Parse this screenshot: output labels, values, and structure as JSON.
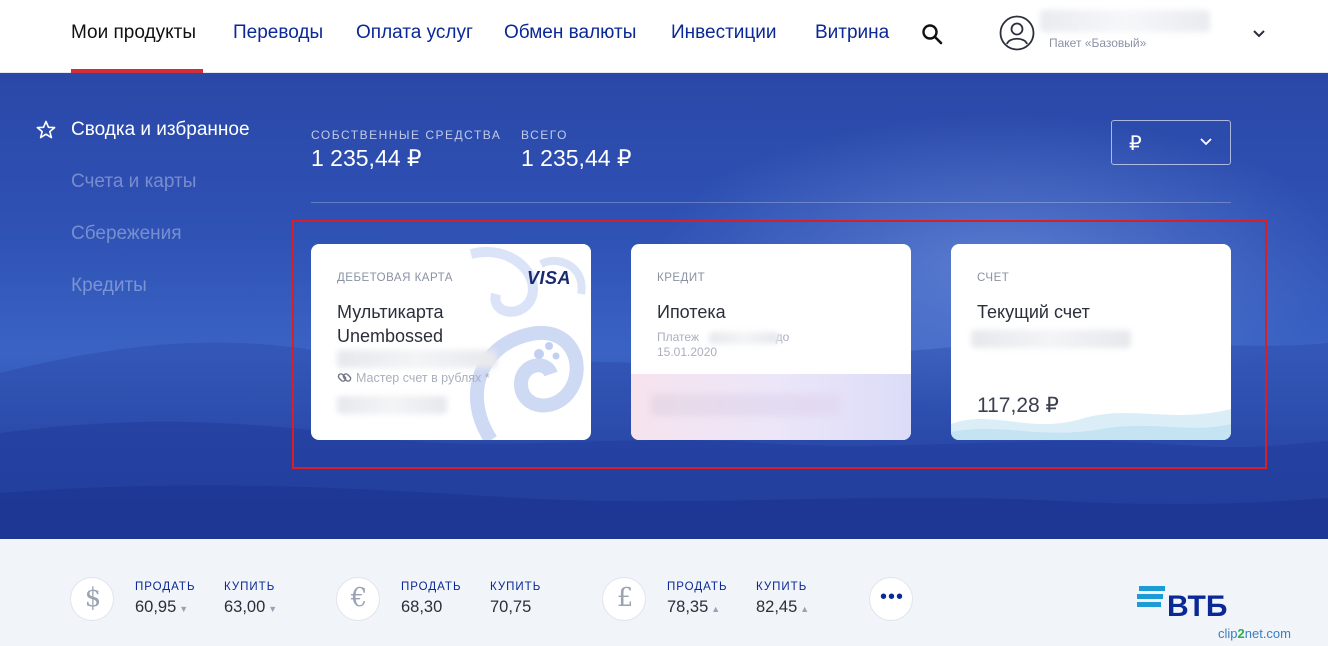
{
  "nav": {
    "items": [
      "Мои продукты",
      "Переводы",
      "Оплата услуг",
      "Обмен валюты",
      "Инвестиции",
      "Витрина"
    ],
    "active_index": 0,
    "package": "Пакет «Базовый»"
  },
  "sidebar": {
    "items": [
      "Сводка и избранное",
      "Счета и карты",
      "Сбережения",
      "Кредиты"
    ],
    "active_index": 0
  },
  "summary": {
    "own_funds_label": "СОБСТВЕННЫЕ СРЕДСТВА",
    "own_funds_value": "1 235,44 ₽",
    "total_label": "ВСЕГО",
    "total_value": "1 235,44 ₽",
    "currency": "₽"
  },
  "cards": [
    {
      "type": "ДЕБЕТОВАЯ КАРТА",
      "title": "Мультикарта Unembossed",
      "brand": "VISA",
      "linked_account": "Мастер счет в рублях *"
    },
    {
      "type": "КРЕДИТ",
      "title": "Ипотека",
      "payment_prefix": "Платеж",
      "payment_suffix": "до",
      "payment_date": "15.01.2020"
    },
    {
      "type": "СЧЕТ",
      "title": "Текущий счет",
      "balance": "117,28 ₽"
    }
  ],
  "rates": [
    {
      "symbol": "$",
      "sell_label": "ПРОДАТЬ",
      "sell": "60,95",
      "buy_label": "КУПИТЬ",
      "buy": "63,00",
      "trend": "down"
    },
    {
      "symbol": "€",
      "sell_label": "ПРОДАТЬ",
      "sell": "68,30",
      "buy_label": "КУПИТЬ",
      "buy": "70,75",
      "trend": "none"
    },
    {
      "symbol": "£",
      "sell_label": "ПРОДАТЬ",
      "sell": "78,35",
      "buy_label": "КУПИТЬ",
      "buy": "82,45",
      "trend": "up"
    }
  ],
  "more_label": "•••",
  "brand": {
    "name": "ВТБ",
    "watermark_a": "clip",
    "watermark_b": "2",
    "watermark_c": "net.com"
  },
  "colors": {
    "accent_blue": "#0a2896",
    "active_red": "#d12e3c",
    "hero_blue": "#2f52b5",
    "highlight_red": "#d81e28"
  }
}
